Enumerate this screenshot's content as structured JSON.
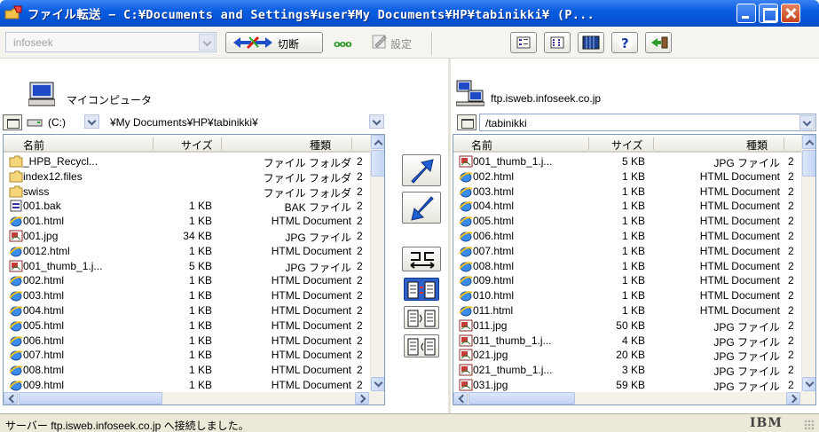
{
  "window": {
    "title": "ファイル転送 − C:¥Documents and Settings¥user¥My Documents¥HP¥tabinikki¥ (P..."
  },
  "toolbar": {
    "site_combo_value": "infoseek",
    "disconnect_label": "切断",
    "connection_indicator": "ooo",
    "settings_label": "設定"
  },
  "local": {
    "label": "マイコンピュータ",
    "drive": "(C:)",
    "path": "¥My Documents¥HP¥tabinikki¥",
    "columns": {
      "name": "名前",
      "size": "サイズ",
      "type": "種類"
    },
    "files": [
      {
        "name": "_HPB_Recycl...",
        "size": "",
        "type": "ファイル フォルダ",
        "date": "2",
        "icon": "folder-icon"
      },
      {
        "name": "index12.files",
        "size": "",
        "type": "ファイル フォルダ",
        "date": "2",
        "icon": "folder-icon"
      },
      {
        "name": "swiss",
        "size": "",
        "type": "ファイル フォルダ",
        "date": "2",
        "icon": "folder-icon"
      },
      {
        "name": "001.bak",
        "size": "1 KB",
        "type": "BAK ファイル",
        "date": "2",
        "icon": "bak-file-icon"
      },
      {
        "name": "001.html",
        "size": "1 KB",
        "type": "HTML Document",
        "date": "2",
        "icon": "html-file-icon"
      },
      {
        "name": "001.jpg",
        "size": "34 KB",
        "type": "JPG ファイル",
        "date": "2",
        "icon": "jpg-file-icon"
      },
      {
        "name": "0012.html",
        "size": "1 KB",
        "type": "HTML Document",
        "date": "2",
        "icon": "html-file-icon"
      },
      {
        "name": "001_thumb_1.j...",
        "size": "5 KB",
        "type": "JPG ファイル",
        "date": "2",
        "icon": "jpg-file-icon"
      },
      {
        "name": "002.html",
        "size": "1 KB",
        "type": "HTML Document",
        "date": "2",
        "icon": "html-file-icon"
      },
      {
        "name": "003.html",
        "size": "1 KB",
        "type": "HTML Document",
        "date": "2",
        "icon": "html-file-icon"
      },
      {
        "name": "004.html",
        "size": "1 KB",
        "type": "HTML Document",
        "date": "2",
        "icon": "html-file-icon"
      },
      {
        "name": "005.html",
        "size": "1 KB",
        "type": "HTML Document",
        "date": "2",
        "icon": "html-file-icon"
      },
      {
        "name": "006.html",
        "size": "1 KB",
        "type": "HTML Document",
        "date": "2",
        "icon": "html-file-icon"
      },
      {
        "name": "007.html",
        "size": "1 KB",
        "type": "HTML Document",
        "date": "2",
        "icon": "html-file-icon"
      },
      {
        "name": "008.html",
        "size": "1 KB",
        "type": "HTML Document",
        "date": "2",
        "icon": "html-file-icon"
      },
      {
        "name": "009.html",
        "size": "1 KB",
        "type": "HTML Document",
        "date": "2",
        "icon": "html-file-icon"
      }
    ]
  },
  "remote": {
    "label": "ftp.isweb.infoseek.co.jp",
    "path": "/tabinikki",
    "columns": {
      "name": "名前",
      "size": "サイズ",
      "type": "種類"
    },
    "files": [
      {
        "name": "001_thumb_1.j...",
        "size": "5 KB",
        "type": "JPG ファイル",
        "date": "2",
        "icon": "jpg-file-icon"
      },
      {
        "name": "002.html",
        "size": "1 KB",
        "type": "HTML Document",
        "date": "2",
        "icon": "html-file-icon"
      },
      {
        "name": "003.html",
        "size": "1 KB",
        "type": "HTML Document",
        "date": "2",
        "icon": "html-file-icon"
      },
      {
        "name": "004.html",
        "size": "1 KB",
        "type": "HTML Document",
        "date": "2",
        "icon": "html-file-icon"
      },
      {
        "name": "005.html",
        "size": "1 KB",
        "type": "HTML Document",
        "date": "2",
        "icon": "html-file-icon"
      },
      {
        "name": "006.html",
        "size": "1 KB",
        "type": "HTML Document",
        "date": "2",
        "icon": "html-file-icon"
      },
      {
        "name": "007.html",
        "size": "1 KB",
        "type": "HTML Document",
        "date": "2",
        "icon": "html-file-icon"
      },
      {
        "name": "008.html",
        "size": "1 KB",
        "type": "HTML Document",
        "date": "2",
        "icon": "html-file-icon"
      },
      {
        "name": "009.html",
        "size": "1 KB",
        "type": "HTML Document",
        "date": "2",
        "icon": "html-file-icon"
      },
      {
        "name": "010.html",
        "size": "1 KB",
        "type": "HTML Document",
        "date": "2",
        "icon": "html-file-icon"
      },
      {
        "name": "011.html",
        "size": "1 KB",
        "type": "HTML Document",
        "date": "2",
        "icon": "html-file-icon"
      },
      {
        "name": "011.jpg",
        "size": "50 KB",
        "type": "JPG ファイル",
        "date": "2",
        "icon": "jpg-file-icon"
      },
      {
        "name": "011_thumb_1.j...",
        "size": "4 KB",
        "type": "JPG ファイル",
        "date": "2",
        "icon": "jpg-file-icon"
      },
      {
        "name": "021.jpg",
        "size": "20 KB",
        "type": "JPG ファイル",
        "date": "2",
        "icon": "jpg-file-icon"
      },
      {
        "name": "021_thumb_1.j...",
        "size": "3 KB",
        "type": "JPG ファイル",
        "date": "2",
        "icon": "jpg-file-icon"
      },
      {
        "name": "031.jpg",
        "size": "59 KB",
        "type": "JPG ファイル",
        "date": "2",
        "icon": "jpg-file-icon"
      }
    ]
  },
  "status": {
    "message": "サーバー ftp.isweb.infoseek.co.jp へ接続しました。",
    "brand": "IBM"
  }
}
